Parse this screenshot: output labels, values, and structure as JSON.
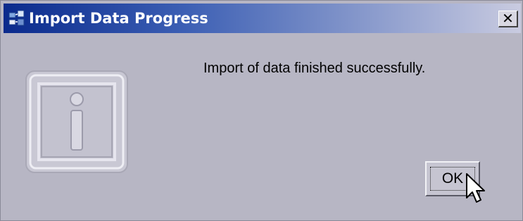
{
  "window": {
    "title": "Import Data Progress",
    "close_label": "✕"
  },
  "dialog": {
    "message": "Import of data finished successfully.",
    "icon": "information-icon",
    "ok_label": "OK"
  },
  "colors": {
    "titlebar_start": "#0a2a8c",
    "titlebar_end": "#c9cbe0",
    "dialog_background": "#b7b6c4"
  }
}
